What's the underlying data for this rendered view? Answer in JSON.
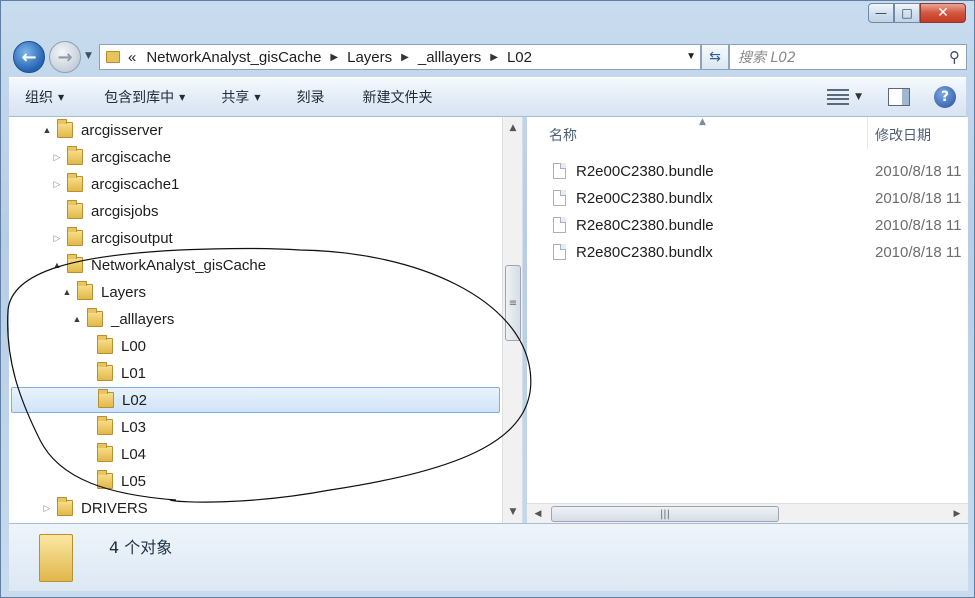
{
  "window": {
    "caption": {
      "min": "—",
      "max": "□",
      "close": "✕"
    }
  },
  "navigation": {
    "back_icon": "arrow-left-icon",
    "forward_icon": "arrow-right-icon",
    "address_prefix": "«",
    "breadcrumbs": [
      "NetworkAnalyst_gisCache",
      "Layers",
      "_alllayers",
      "L02"
    ],
    "search_placeholder": "搜索 L02"
  },
  "toolbar": {
    "organize": "组织",
    "include_in_library": "包含到库中",
    "share": "共享",
    "burn": "刻录",
    "new_folder": "新建文件夹",
    "help": "?"
  },
  "tree": {
    "items": [
      {
        "label": "arcgisserver",
        "expander": "▲"
      },
      {
        "label": "arcgiscache",
        "expander": "▷"
      },
      {
        "label": "arcgiscache1",
        "expander": "▷"
      },
      {
        "label": "arcgisjobs",
        "expander": ""
      },
      {
        "label": "arcgisoutput",
        "expander": "▷"
      },
      {
        "label": "NetworkAnalyst_gisCache",
        "expander": "▲"
      },
      {
        "label": "Layers",
        "expander": "▲"
      },
      {
        "label": "_alllayers",
        "expander": "▲"
      },
      {
        "label": "L00",
        "expander": ""
      },
      {
        "label": "L01",
        "expander": ""
      },
      {
        "label": "L02",
        "expander": ""
      },
      {
        "label": "L03",
        "expander": ""
      },
      {
        "label": "L04",
        "expander": ""
      },
      {
        "label": "L05",
        "expander": ""
      },
      {
        "label": "DRIVERS",
        "expander": "▷"
      }
    ],
    "selected": "L02"
  },
  "file_list": {
    "columns": {
      "name": "名称",
      "date": "修改日期"
    },
    "files": [
      {
        "name": "R2e00C2380.bundle",
        "date": "2010/8/18 11"
      },
      {
        "name": "R2e00C2380.bundlx",
        "date": "2010/8/18 11"
      },
      {
        "name": "R2e80C2380.bundle",
        "date": "2010/8/18 11"
      },
      {
        "name": "R2e80C2380.bundlx",
        "date": "2010/8/18 11"
      }
    ]
  },
  "status": {
    "count_text": "4 个对象"
  }
}
